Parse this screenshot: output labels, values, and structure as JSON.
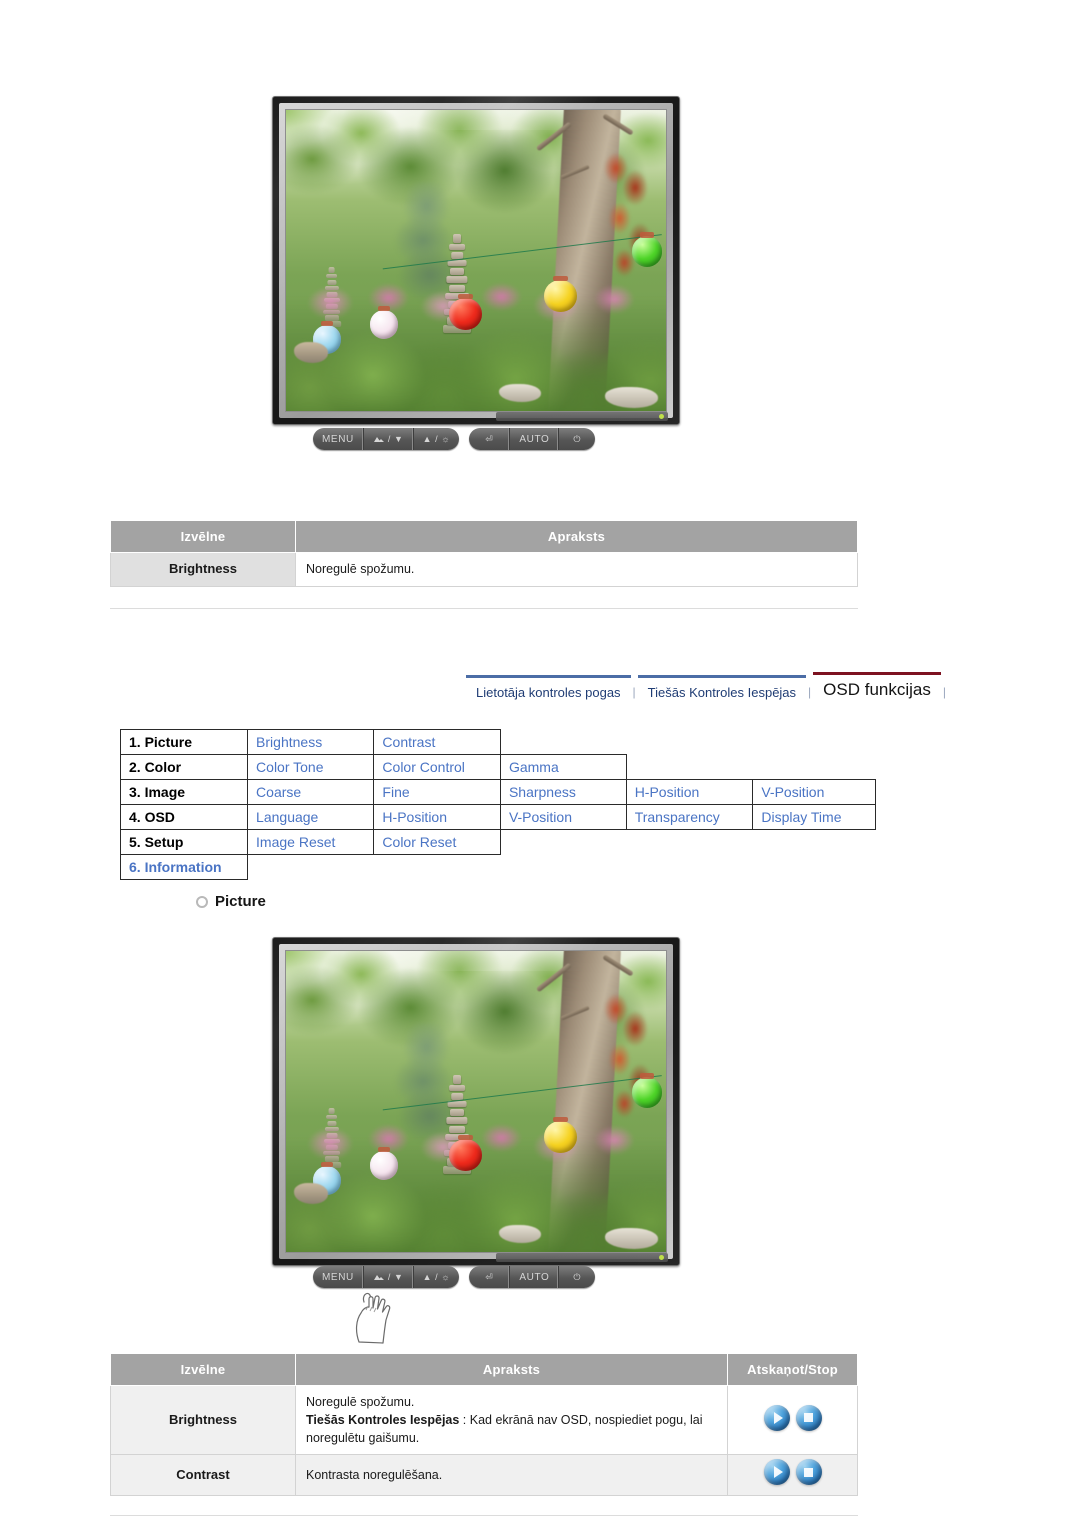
{
  "document": {
    "language": "Latvian",
    "title": "OSD funkcijas"
  },
  "nav": {
    "items": [
      {
        "label": "Lietotāja kontroles pogas",
        "active": false
      },
      {
        "label": "Tiešās Kontroles Iespējas",
        "active": false
      },
      {
        "label": "OSD funkcijas",
        "active": true
      }
    ],
    "separator": "|",
    "active_underline_color": "#7d1220",
    "inactive_underline_color": "#4b6da6",
    "link_color": "#1f3c74"
  },
  "monitor_top": {
    "alt": "LCD monitor displaying a garden photo with stone pagoda and paper lanterns",
    "buttons": [
      {
        "label": "MENU",
        "icon": "menu-button"
      },
      {
        "label": "/ ▼",
        "icon": "image-down-button"
      },
      {
        "label": "▲ / ☼",
        "icon": "up-brightness-button"
      },
      {
        "label": "⏎",
        "icon": "enter-button"
      },
      {
        "label": "AUTO",
        "icon": "auto-button"
      },
      {
        "label": "⏻",
        "icon": "power-button"
      }
    ]
  },
  "monitor_bottom": {
    "alt": "LCD monitor with hand pressing the MENU button",
    "buttons": [
      {
        "label": "MENU",
        "icon": "menu-button"
      },
      {
        "label": "/ ▼",
        "icon": "image-down-button"
      },
      {
        "label": "▲ / ☼",
        "icon": "up-brightness-button"
      },
      {
        "label": "⏎",
        "icon": "enter-button"
      },
      {
        "label": "AUTO",
        "icon": "auto-button"
      },
      {
        "label": "⏻",
        "icon": "power-button"
      }
    ],
    "cursor": "hand-pointer-icon"
  },
  "table_top": {
    "headers": [
      "Izvēlne",
      "Apraksts"
    ],
    "rows": [
      {
        "menu": "Brightness",
        "description": "Noregulē spožumu."
      }
    ]
  },
  "osd_map": {
    "rows": [
      {
        "group": "1. Picture",
        "group_is_link": false,
        "items": [
          "Brightness",
          "Contrast"
        ]
      },
      {
        "group": "2. Color",
        "group_is_link": false,
        "items": [
          "Color Tone",
          "Color Control",
          "Gamma"
        ]
      },
      {
        "group": "3. Image",
        "group_is_link": false,
        "items": [
          "Coarse",
          "Fine",
          "Sharpness",
          "H-Position",
          "V-Position"
        ]
      },
      {
        "group": "4. OSD",
        "group_is_link": false,
        "items": [
          "Language",
          "H-Position",
          "V-Position",
          "Transparency",
          "Display Time"
        ]
      },
      {
        "group": "5. Setup",
        "group_is_link": false,
        "items": [
          "Image Reset",
          "Color Reset"
        ]
      },
      {
        "group": "6. Information",
        "group_is_link": true,
        "items": []
      }
    ]
  },
  "section": {
    "heading": "Picture",
    "bullet": "ring-bullet-icon"
  },
  "table_bottom": {
    "headers": [
      "Izvēlne",
      "Apraksts",
      "Atskaņot/Stop"
    ],
    "rows": [
      {
        "menu": "Brightness",
        "line1": "Noregulē spožumu.",
        "bold_lead": "Tiešās Kontroles Iespējas",
        "line2": " : Kad ekrānā nav OSD, nospiediet pogu, lai noregulētu gaišumu.",
        "controls": [
          "play-button",
          "stop-button"
        ]
      },
      {
        "menu": "Contrast",
        "line1": "Kontrasta noregulēšana.",
        "bold_lead": "",
        "line2": "",
        "controls": [
          "play-button",
          "stop-button"
        ]
      }
    ]
  },
  "colors": {
    "table_header_bg": "#a3a3a3",
    "menu_cell_bg": "#e0e0e0",
    "link_blue": "#4a74c4",
    "accent_red": "#7d1220",
    "rule": "#dcdcdc"
  }
}
